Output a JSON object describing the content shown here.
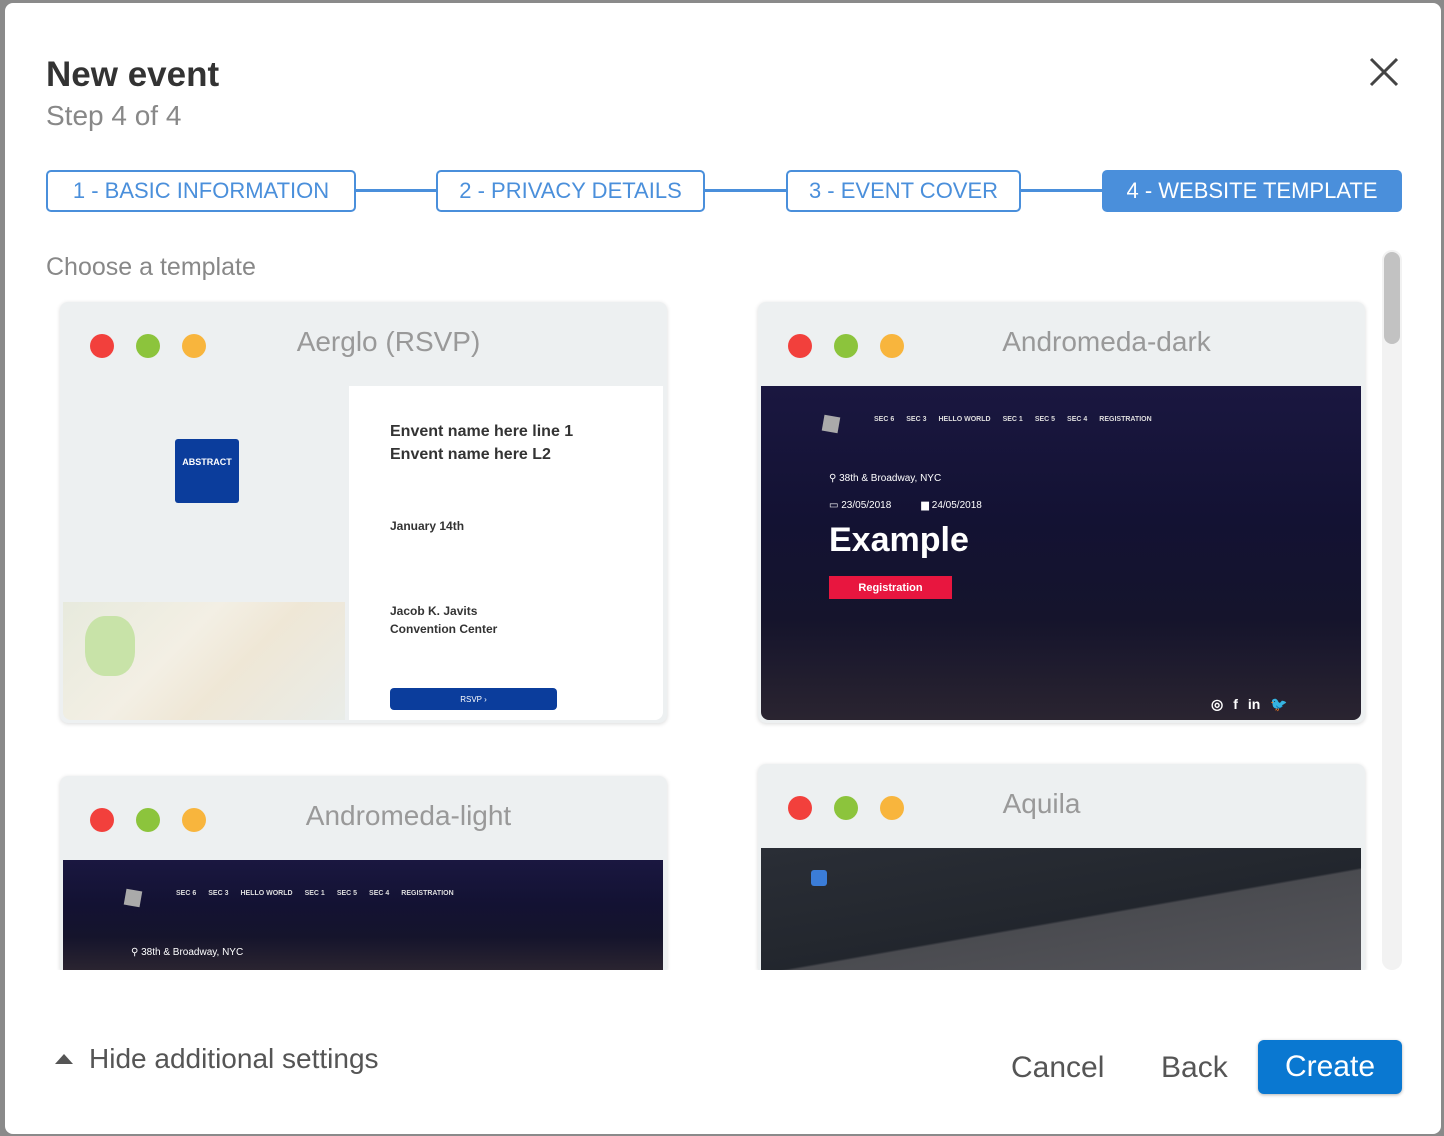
{
  "dialog": {
    "title": "New event",
    "subtitle": "Step 4 of 4"
  },
  "steps": [
    {
      "label": "1 - BASIC INFORMATION",
      "active": false
    },
    {
      "label": "2 - PRIVACY DETAILS",
      "active": false
    },
    {
      "label": "3 - EVENT COVER",
      "active": false
    },
    {
      "label": "4 - WEBSITE TEMPLATE",
      "active": true
    }
  ],
  "section_label": "Choose a template",
  "window_dot_colors": [
    "#f2403c",
    "#8cc43c",
    "#f8b53d"
  ],
  "templates": [
    {
      "name": "Aerglo (RSVP)",
      "preview": {
        "logo": "ABSTRACT",
        "title_line1": "Envent name here line 1",
        "title_line2": "Envent name here L2",
        "date": "January 14th",
        "venue_line1": "Jacob K. Javits",
        "venue_line2": "Convention Center",
        "button": "RSVP ›"
      }
    },
    {
      "name": "Andromeda-dark",
      "preview": {
        "nav": [
          "SEC 6",
          "SEC 3",
          "HELLO WORLD",
          "SEC 1",
          "SEC 5",
          "SEC 4",
          "REGISTRATION"
        ],
        "location": "38th & Broadway, NYC",
        "start_date": "23/05/2018",
        "end_date": "24/05/2018",
        "headline": "Example",
        "button": "Registration",
        "social": [
          "instagram",
          "facebook",
          "linkedin",
          "twitter"
        ]
      }
    },
    {
      "name": "Andromeda-light",
      "preview": {
        "nav": [
          "SEC 6",
          "SEC 3",
          "HELLO WORLD",
          "SEC 1",
          "SEC 5",
          "SEC 4",
          "REGISTRATION"
        ],
        "location": "38th & Broadway, NYC"
      }
    },
    {
      "name": "Aquila"
    }
  ],
  "footer": {
    "toggle_label": "Hide additional settings",
    "cancel": "Cancel",
    "back": "Back",
    "create": "Create"
  },
  "colors": {
    "accent": "#4a8fdb",
    "primary_button": "#0a78d1"
  }
}
